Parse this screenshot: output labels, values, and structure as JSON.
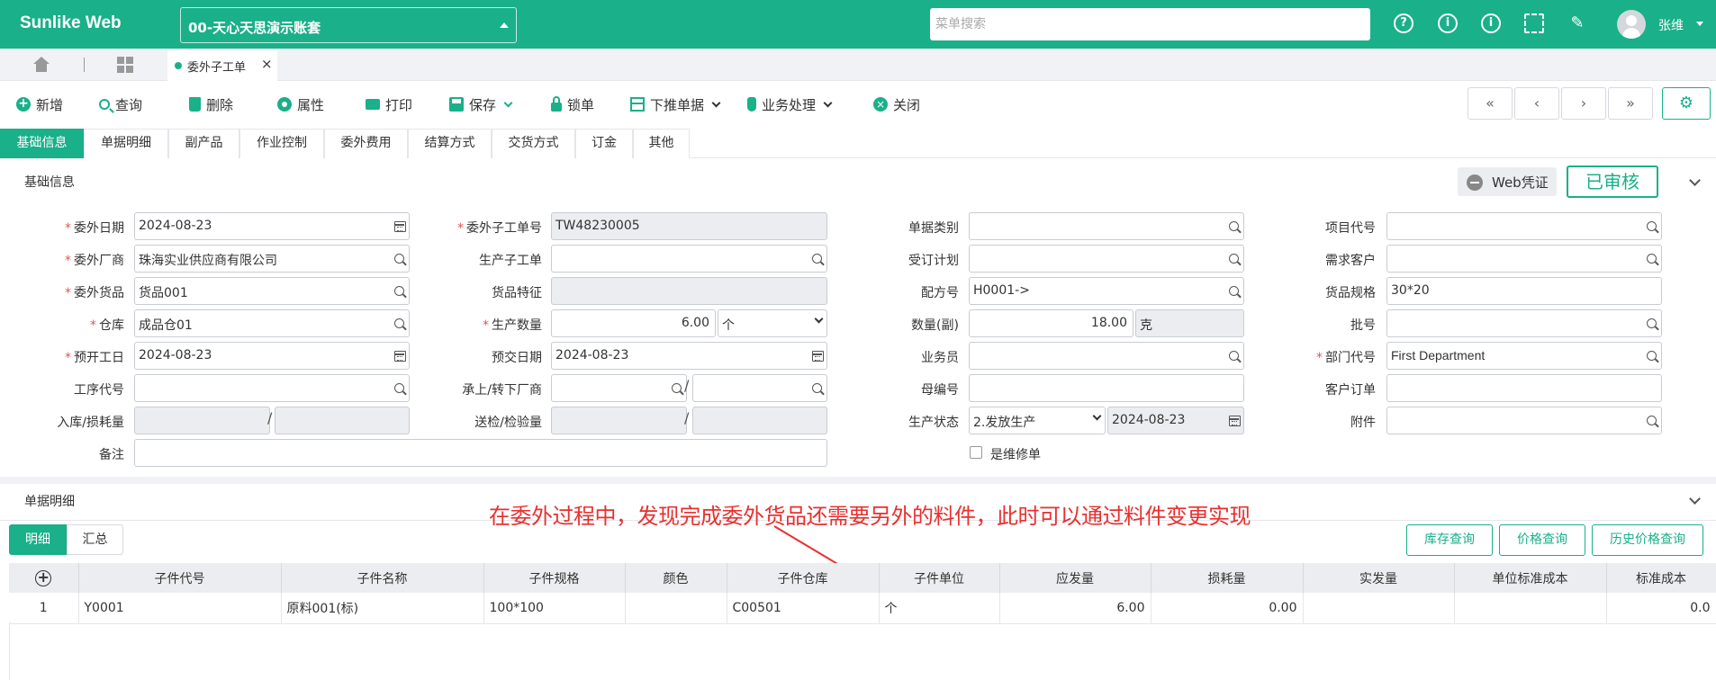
{
  "app": {
    "brand": "Sunlike Web",
    "account": "00-天心天思演示账套",
    "menu_search_placeholder": "菜单搜索",
    "user": "张维"
  },
  "topbar_icons": [
    "help-icon",
    "info-icon",
    "info-icon",
    "fullscreen-icon",
    "broom-icon"
  ],
  "tabs": {
    "doc_tab": "委外子工单",
    "close": "×"
  },
  "toolbar": {
    "add": "新增",
    "query": "查询",
    "delete": "删除",
    "props": "属性",
    "print": "打印",
    "save": "保存",
    "lock": "锁单",
    "push": "下推单据",
    "business": "业务处理",
    "close": "关闭"
  },
  "nav_buttons": [
    "«",
    "‹",
    "›",
    "»"
  ],
  "section_tabs": [
    "基础信息",
    "单据明细",
    "副产品",
    "作业控制",
    "委外费用",
    "结算方式",
    "交货方式",
    "订金",
    "其他"
  ],
  "basic": {
    "title": "基础信息",
    "web_voucher": "Web凭证",
    "status": "已审核"
  },
  "form": {
    "outsource_date": {
      "label": "委外日期",
      "value": "2024-08-23"
    },
    "sub_order_no": {
      "label": "委外子工单号",
      "value": "TW48230005"
    },
    "doc_type": {
      "label": "单据类别",
      "value": ""
    },
    "project_code": {
      "label": "项目代号",
      "value": ""
    },
    "vendor": {
      "label": "委外厂商",
      "value": "珠海实业供应商有限公司"
    },
    "prod_sub_order": {
      "label": "生产子工单",
      "value": ""
    },
    "order_plan": {
      "label": "受订计划",
      "value": ""
    },
    "demand_customer": {
      "label": "需求客户",
      "value": ""
    },
    "goods": {
      "label": "委外货品",
      "value": "货品001"
    },
    "goods_feature": {
      "label": "货品特征",
      "value": ""
    },
    "recipe_no": {
      "label": "配方号",
      "value": "H0001->"
    },
    "goods_spec": {
      "label": "货品规格",
      "value": "30*20"
    },
    "warehouse": {
      "label": "仓库",
      "value": "成品仓01"
    },
    "prod_qty": {
      "label": "生产数量",
      "value": "6.00",
      "unit": "个"
    },
    "qty_sub": {
      "label": "数量(副)",
      "value": "18.00",
      "unit": "克"
    },
    "batch_no": {
      "label": "批号",
      "value": ""
    },
    "plan_start": {
      "label": "预开工日",
      "value": "2024-08-23"
    },
    "plan_delivery": {
      "label": "预交日期",
      "value": "2024-08-23"
    },
    "salesman": {
      "label": "业务员",
      "value": ""
    },
    "dept_code": {
      "label": "部门代号",
      "value": "First Department"
    },
    "process_code": {
      "label": "工序代号",
      "value": ""
    },
    "transfer_vendor": {
      "label": "承上/转下厂商",
      "value": ""
    },
    "parent_no": {
      "label": "母编号",
      "value": ""
    },
    "customer_order": {
      "label": "客户订单",
      "value": ""
    },
    "stock_loss": {
      "label": "入库/损耗量",
      "value": ""
    },
    "inspect_qty": {
      "label": "送检/检验量",
      "value": ""
    },
    "prod_status": {
      "label": "生产状态",
      "value": "2.发放生产",
      "date": "2024-08-23"
    },
    "attachment": {
      "label": "附件",
      "value": ""
    },
    "remark": {
      "label": "备注",
      "value": ""
    },
    "repair": {
      "label": "是维修单"
    }
  },
  "detail": {
    "title": "单据明细",
    "subtabs": [
      "明细",
      "汇总"
    ],
    "query_buttons": [
      "库存查询",
      "价格查询",
      "历史价格查询"
    ],
    "annotation": "在委外过程中，发现完成委外货品还需要另外的料件，此时可以通过料件变更实现",
    "columns": [
      "⊕",
      "子件代号",
      "子件名称",
      "子件规格",
      "颜色",
      "子件仓库",
      "子件单位",
      "应发量",
      "损耗量",
      "实发量",
      "单位标准成本",
      "标准成本"
    ],
    "rows": [
      [
        "1",
        "Y0001",
        "原料001(标)",
        "100*100",
        "",
        "C00501",
        "个",
        "6.00",
        "0.00",
        "",
        "",
        "0.0"
      ]
    ]
  },
  "colors": {
    "brand": "#19b08a",
    "annotation": "#e8302f"
  }
}
